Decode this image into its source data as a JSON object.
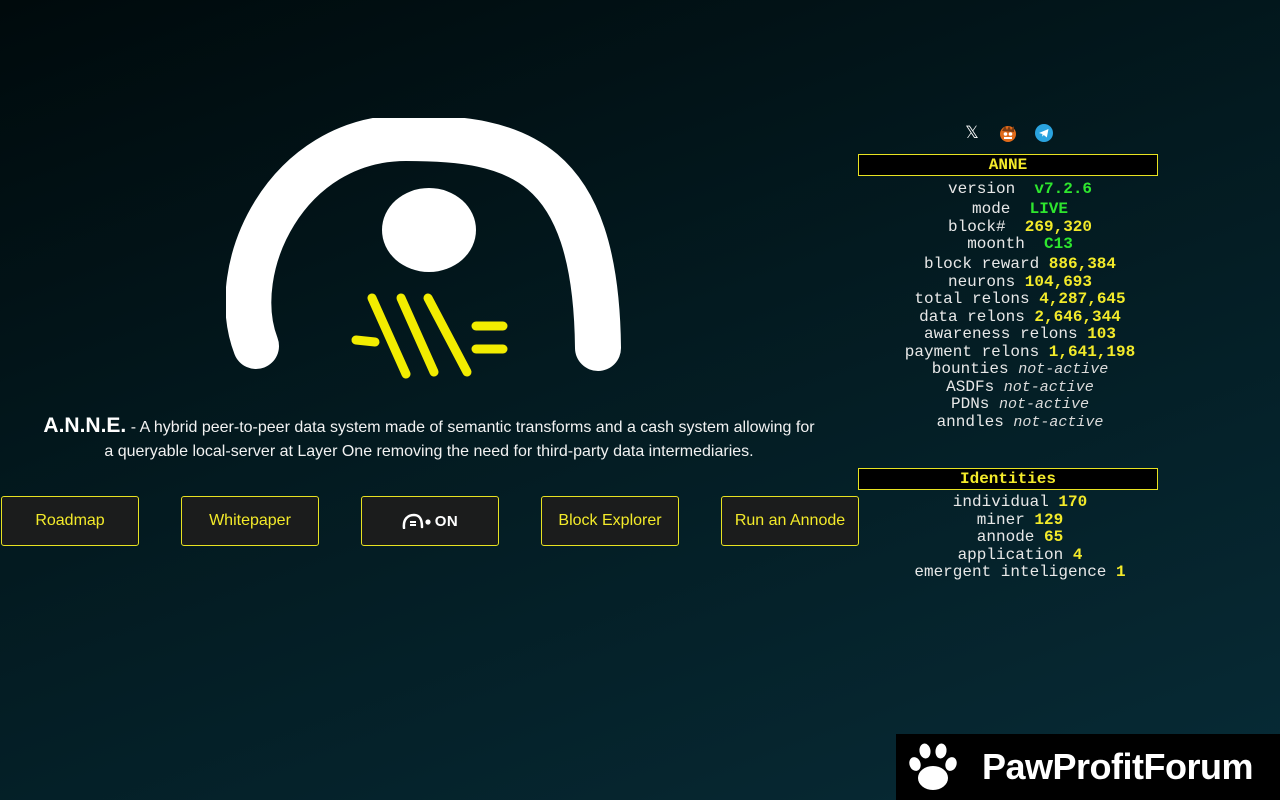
{
  "intro": {
    "brand": "A.N.N.E.",
    "text": " - A hybrid peer-to-peer data system made of semantic transforms and a cash system allowing for a queryable local-server at Layer One removing the need for third-party data intermediaries."
  },
  "nav": {
    "buttons": [
      {
        "label": "Roadmap"
      },
      {
        "label": "Whitepaper"
      },
      {
        "label": "ON"
      },
      {
        "label": "Block Explorer"
      },
      {
        "label": "Run an Annode"
      }
    ]
  },
  "socials": [
    {
      "icon": "x-icon",
      "glyph": "𝕏"
    },
    {
      "icon": "monster-avatar-icon"
    },
    {
      "icon": "telegram-icon"
    }
  ],
  "anne": {
    "title": "ANNE",
    "rows": [
      {
        "label": "version",
        "value": "v7.2.6"
      },
      {
        "label": "mode",
        "value": "LIVE"
      },
      {
        "label": "block#",
        "value": "269,320"
      },
      {
        "label": "moonth",
        "value": "C13"
      },
      {
        "label": "block reward",
        "value": "886,384"
      },
      {
        "label": "neurons",
        "value": "104,693"
      },
      {
        "label": "total relons",
        "value": "4,287,645"
      },
      {
        "label": "data relons",
        "value": "2,646,344"
      },
      {
        "label": "awareness relons",
        "value": "103"
      },
      {
        "label": "payment relons",
        "value": "1,641,198"
      },
      {
        "label": "bounties",
        "value": "not-active"
      },
      {
        "label": "ASDFs",
        "value": "not-active"
      },
      {
        "label": "PDNs",
        "value": "not-active"
      },
      {
        "label": "anndles",
        "value": "not-active"
      }
    ]
  },
  "identities": {
    "title": "Identities",
    "rows": [
      {
        "label": "individual",
        "value": "170"
      },
      {
        "label": "miner",
        "value": "129"
      },
      {
        "label": "annode",
        "value": "65"
      },
      {
        "label": "application",
        "value": "4"
      },
      {
        "label": "emergent inteligence",
        "value": "1"
      }
    ]
  },
  "watermark": {
    "text": "PawProfitForum"
  },
  "colors": {
    "accent": "#f3ea2a",
    "live": "#2ee62e",
    "background": "#031a20",
    "button_bg": "#1b1c1c"
  }
}
